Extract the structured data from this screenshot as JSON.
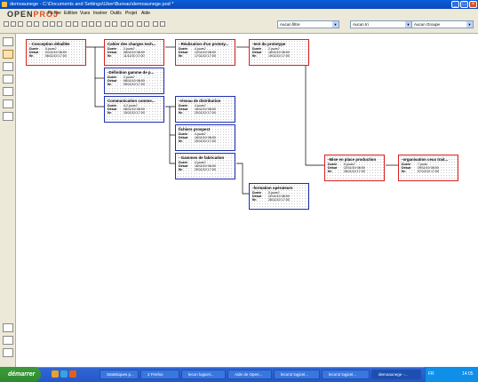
{
  "window": {
    "title": "demoaunege - C:\\Documents and Settings\\Uker\\Bureau\\demoaunege.pod *"
  },
  "logo": {
    "part1": "OPEN",
    "part2": "PROJ"
  },
  "menu": [
    "Fichier",
    "Edition",
    "Vues",
    "Insérer",
    "Outils",
    "Projet",
    "Aide"
  ],
  "filters": {
    "filter": "Aucun filtre",
    "sort": "Aucun tri",
    "group": "Aucun Groupe"
  },
  "labels": {
    "duration": "Durée",
    "start": "Début",
    "end": "fin"
  },
  "nodes": [
    {
      "title": "- Conception détaillée",
      "duration": "5 jours?",
      "start": "01/11/10 08:00",
      "end": "06/11/10 17:00"
    },
    {
      "title": "Cahier des charges tech...",
      "duration": "3 jours?",
      "start": "08/11/10 08:00",
      "end": "11/11/10 17:00"
    },
    {
      "title": "- Réalisation d'un prototy...",
      "duration": "4 jours?",
      "start": "12/11/10 08:00",
      "end": "17/11/10 17:00"
    },
    {
      "title": "-test du prototype",
      "duration": "2 jours?",
      "start": "18/11/10 08:00",
      "end": "19/11/10 17:00"
    },
    {
      "title": "-Définition gamme de p...",
      "duration": "2 jours?",
      "start": "08/11/10 08:00",
      "end": "09/11/10 17:00"
    },
    {
      "title": "Communication comme...",
      "duration": "4.2 jours?",
      "start": "08/11/10 08:00",
      "end": "15/11/10 17:00"
    },
    {
      "title": "-réseau de distribution",
      "duration": "4 jours?",
      "start": "16/11/10 08:00",
      "end": "20/11/10 17:00"
    },
    {
      "title": "fichiers prospect",
      "duration": "4 jours?",
      "start": "16/11/10 08:00",
      "end": "20/11/10 17:00"
    },
    {
      "title": "- Gammes de fabrication",
      "duration": "4 jours?",
      "start": "16/11/10 08:00",
      "end": "20/11/10 17:00"
    },
    {
      "title": "-formation opérateurs",
      "duration": "5 jours?",
      "start": "22/11/10 08:00",
      "end": "26/11/10 17:00"
    },
    {
      "title": "-Mise en place production",
      "duration": "5 jours?",
      "start": "22/11/10 08:00",
      "end": "26/11/10 17:00"
    },
    {
      "title": "-organisation ceux trait...",
      "duration": "7 jours",
      "start": "29/11/10 08:00",
      "end": "07/12/10 17:00"
    }
  ],
  "taskbar": {
    "start": "démarrer",
    "items": [
      "Statistiques p...",
      "2 Firefox",
      "lecon logicel...",
      "Aide de Open...",
      "lecon2 logicel...",
      "lecon2 logicel...",
      "demoaunege -..."
    ],
    "lang": "FR",
    "clock": "14:05"
  }
}
